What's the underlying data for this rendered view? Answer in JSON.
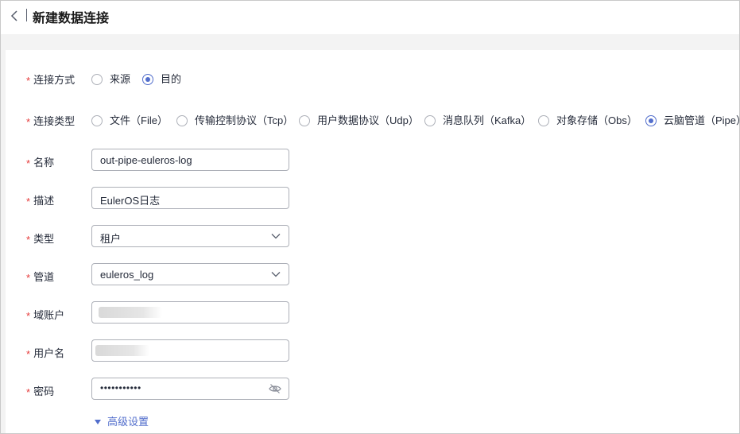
{
  "header": {
    "title": "新建数据连接"
  },
  "form": {
    "mode": {
      "label": "连接方式",
      "options": [
        {
          "label": "来源",
          "checked": false
        },
        {
          "label": "目的",
          "checked": true
        }
      ]
    },
    "type": {
      "label": "连接类型",
      "options": [
        {
          "label": "文件（File）",
          "checked": false
        },
        {
          "label": "传输控制协议（Tcp）",
          "checked": false
        },
        {
          "label": "用户数据协议（Udp）",
          "checked": false
        },
        {
          "label": "消息队列（Kafka）",
          "checked": false
        },
        {
          "label": "对象存储（Obs）",
          "checked": false
        },
        {
          "label": "云脑管道（Pipe）",
          "checked": true
        }
      ]
    },
    "name": {
      "label": "名称",
      "value": "out-pipe-euleros-log"
    },
    "description": {
      "label": "描述",
      "value": "EulerOS日志"
    },
    "kind": {
      "label": "类型",
      "value": "租户"
    },
    "pipe": {
      "label": "管道",
      "value": "euleros_log"
    },
    "domain_account": {
      "label": "域账户"
    },
    "username": {
      "label": "用户名"
    },
    "password": {
      "label": "密码",
      "value": "•••••••••••"
    },
    "advanced": {
      "label": "高级设置"
    }
  },
  "required_mark": "*",
  "colors": {
    "accent": "#526ecc",
    "required": "#e63a3a"
  },
  "icons": [
    "back-arrow-icon",
    "chevron-down-icon",
    "eye-off-icon",
    "caret-down-icon"
  ]
}
